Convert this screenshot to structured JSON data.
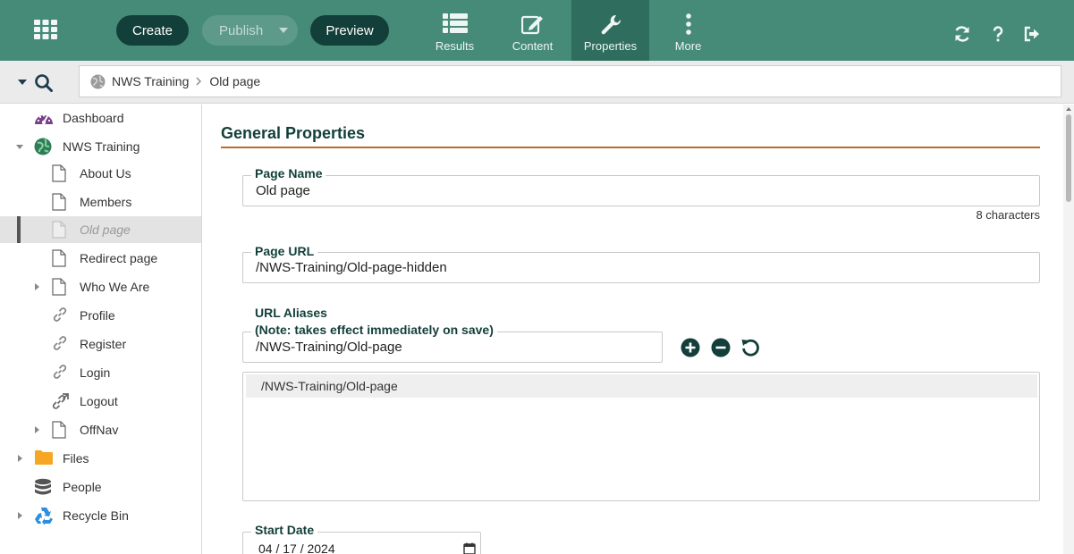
{
  "topbar": {
    "create_label": "Create",
    "publish_label": "Publish",
    "preview_label": "Preview",
    "tabs": [
      {
        "label": "Results",
        "icon": "list-icon"
      },
      {
        "label": "Content",
        "icon": "edit-icon"
      },
      {
        "label": "Properties",
        "icon": "wrench-icon",
        "active": true
      },
      {
        "label": "More",
        "icon": "more-vertical-icon"
      }
    ],
    "right_icons": [
      "refresh-icon",
      "help-icon",
      "logout-icon"
    ]
  },
  "breadcrumb": {
    "items": [
      "NWS Training",
      "Old page"
    ]
  },
  "sidebar": {
    "items": [
      {
        "label": "Dashboard",
        "icon": "dashboard-icon"
      },
      {
        "label": "NWS Training",
        "icon": "globe-icon",
        "expanded": true
      },
      {
        "label": "About Us",
        "icon": "page-icon"
      },
      {
        "label": "Members",
        "icon": "page-icon"
      },
      {
        "label": "Old page",
        "icon": "page-icon",
        "selected": true
      },
      {
        "label": "Redirect page",
        "icon": "page-icon"
      },
      {
        "label": "Who We Are",
        "icon": "page-icon"
      },
      {
        "label": "Profile",
        "icon": "link-icon"
      },
      {
        "label": "Register",
        "icon": "link-icon"
      },
      {
        "label": "Login",
        "icon": "link-icon"
      },
      {
        "label": "Logout",
        "icon": "external-link-icon"
      },
      {
        "label": "OffNav",
        "icon": "page-icon"
      },
      {
        "label": "Files",
        "icon": "folder-icon"
      },
      {
        "label": "People",
        "icon": "database-icon"
      },
      {
        "label": "Recycle Bin",
        "icon": "recycle-icon"
      }
    ]
  },
  "main": {
    "section_title": "General Properties",
    "page_name": {
      "label": "Page Name",
      "value": "Old page",
      "char_count": "8 characters"
    },
    "page_url": {
      "label": "Page URL",
      "value": "/NWS-Training/Old-page-hidden"
    },
    "url_aliases": {
      "label": "URL Aliases",
      "note": "(Note: takes effect immediately on save)",
      "input_value": "/NWS-Training/Old-page",
      "list": [
        "/NWS-Training/Old-page"
      ]
    },
    "start_date": {
      "label": "Start Date",
      "value": "04 / 17 / 2024"
    }
  },
  "colors": {
    "topbar": "#458b78",
    "dark_teal": "#123f3a",
    "accent_rule": "#b86e2e"
  }
}
